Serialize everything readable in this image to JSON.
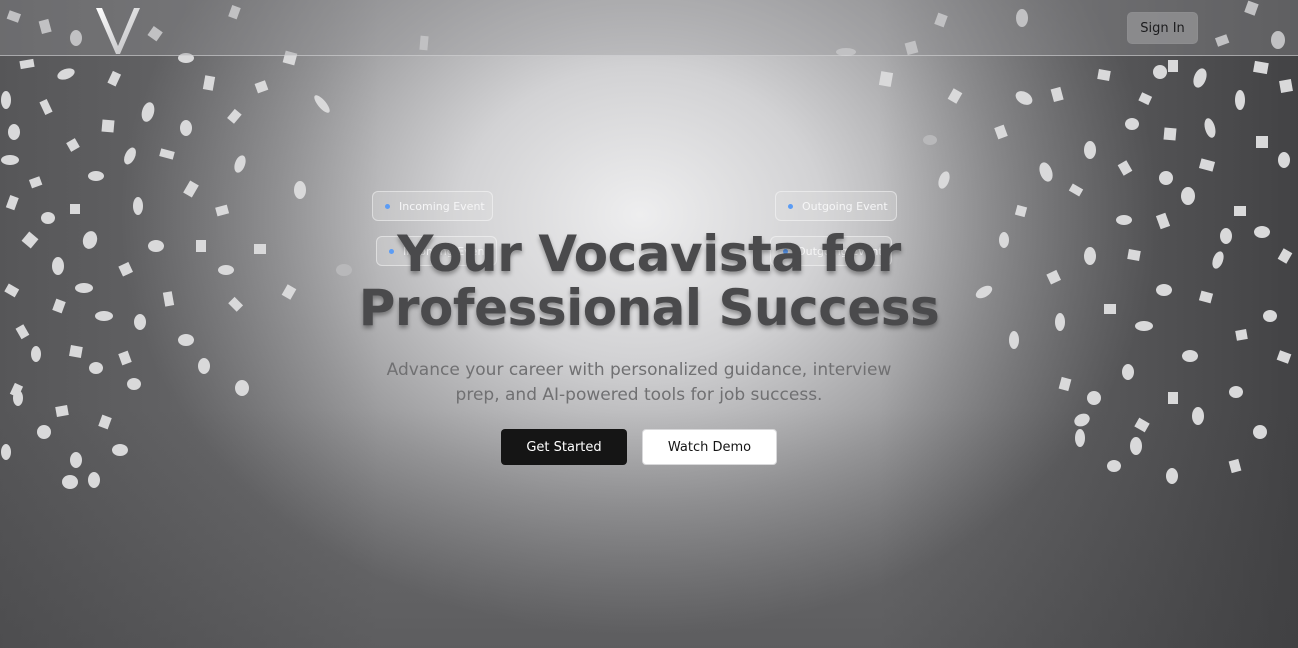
{
  "app": {
    "brand_logo": "V-logo",
    "accent_color": "#5b9cf5"
  },
  "nav": {
    "sign_in_label": "Sign In"
  },
  "events": [
    {
      "label": "Incoming Event"
    },
    {
      "label": "Outgoing Event"
    },
    {
      "label": "Incoming Event"
    },
    {
      "label": "Outgoing Event"
    }
  ],
  "hero": {
    "headline_line1": "Your Vocavista for",
    "headline_line2": "Professional Success",
    "subtitle": "Advance your career with personalized guidance, interview prep, and AI-powered tools for job success.",
    "primary_cta": "Get Started",
    "secondary_cta": "Watch Demo"
  }
}
